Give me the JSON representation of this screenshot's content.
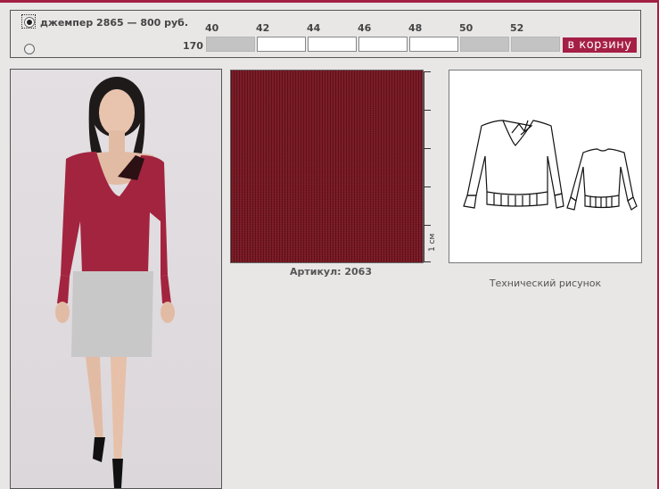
{
  "product": {
    "title": "джемпер  2865 — 800 руб.",
    "selected": true
  },
  "sizes": [
    "40",
    "42",
    "44",
    "46",
    "48",
    "50",
    "52"
  ],
  "height": "170",
  "availability": [
    false,
    true,
    true,
    true,
    true,
    false,
    false
  ],
  "cart_button": "в корзину",
  "fabric": {
    "ruler_label": "1 см",
    "article": "Артикул: 2063"
  },
  "tech_caption": "Технический рисунок",
  "colors": {
    "accent": "#a51f45",
    "sweater": "#a3243f",
    "fabric": "#7b1520",
    "skirt": "#c8c8c8"
  }
}
